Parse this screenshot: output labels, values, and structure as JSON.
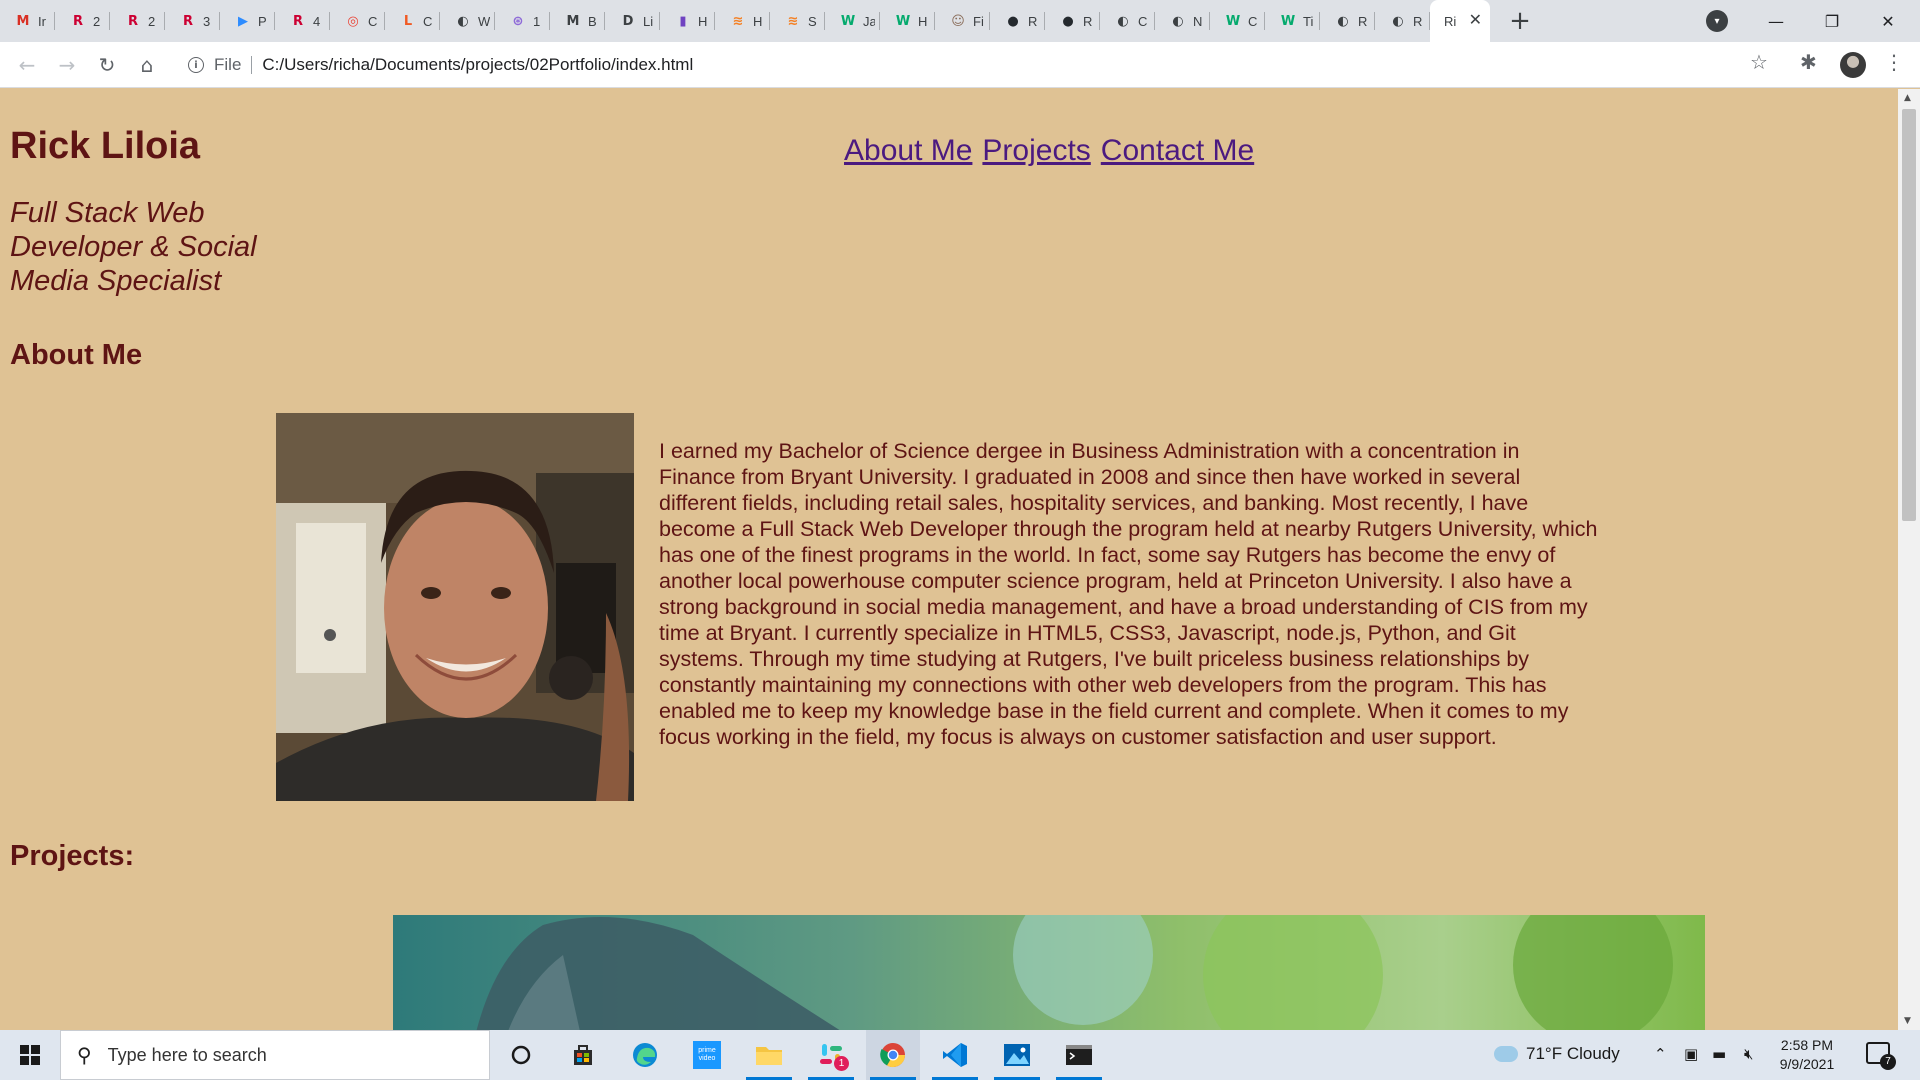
{
  "browser": {
    "tabs": [
      {
        "icon": "gmail-icon",
        "letter": "M",
        "color": "#d93025",
        "label": "Ir"
      },
      {
        "icon": "rutgers-icon",
        "letter": "R",
        "color": "#cc0033",
        "label": "2"
      },
      {
        "icon": "rutgers-icon",
        "letter": "R",
        "color": "#cc0033",
        "label": "2"
      },
      {
        "icon": "rutgers-icon",
        "letter": "R",
        "color": "#cc0033",
        "label": "3"
      },
      {
        "icon": "zoom-icon",
        "letter": "▶",
        "color": "#2d8cff",
        "label": "P"
      },
      {
        "icon": "rutgers-icon",
        "letter": "R",
        "color": "#cc0033",
        "label": "4"
      },
      {
        "icon": "chrome-icon",
        "letter": "◎",
        "color": "#ea4335",
        "label": "C"
      },
      {
        "icon": "codecademy-icon",
        "letter": "L",
        "color": "#f05a24",
        "label": "C"
      },
      {
        "icon": "globe-icon",
        "letter": "◐",
        "color": "#3c4043",
        "label": "W"
      },
      {
        "icon": "swirl-icon",
        "letter": "⊛",
        "color": "#8e6ad8",
        "label": "1"
      },
      {
        "icon": "md-icon",
        "letter": "M",
        "color": "#3c4043",
        "label": "B"
      },
      {
        "icon": "doc-icon",
        "letter": "D",
        "color": "#3c4043",
        "label": "Li"
      },
      {
        "icon": "purple-icon",
        "letter": "▮",
        "color": "#6f42c1",
        "label": "H"
      },
      {
        "icon": "stack-icon",
        "letter": "≋",
        "color": "#f48024",
        "label": "H"
      },
      {
        "icon": "stack-icon",
        "letter": "≋",
        "color": "#f48024",
        "label": "S"
      },
      {
        "icon": "w3schools-icon",
        "letter": "W",
        "color": "#04aa6d",
        "label": "Ja"
      },
      {
        "icon": "w3schools-icon",
        "letter": "W",
        "color": "#04aa6d",
        "label": "H"
      },
      {
        "icon": "avatar-icon",
        "letter": "☺",
        "color": "#8a6d5a",
        "label": "Fi"
      },
      {
        "icon": "github-icon",
        "letter": "●",
        "color": "#24292e",
        "label": "R"
      },
      {
        "icon": "github-icon",
        "letter": "●",
        "color": "#24292e",
        "label": "R"
      },
      {
        "icon": "globe-icon",
        "letter": "◐",
        "color": "#3c4043",
        "label": "C"
      },
      {
        "icon": "globe-icon",
        "letter": "◐",
        "color": "#3c4043",
        "label": "N"
      },
      {
        "icon": "w3schools-icon",
        "letter": "W",
        "color": "#04aa6d",
        "label": "C"
      },
      {
        "icon": "w3schools-icon",
        "letter": "W",
        "color": "#04aa6d",
        "label": "Ti"
      },
      {
        "icon": "globe-icon",
        "letter": "◐",
        "color": "#3c4043",
        "label": "R"
      },
      {
        "icon": "globe-icon",
        "letter": "◐",
        "color": "#3c4043",
        "label": "R"
      }
    ],
    "active_tab_label": "Ri",
    "new_tab_symbol": "+",
    "omnibox_scheme": "File",
    "omnibox_url": "C:/Users/richa/Documents/projects/02Portfolio/index.html"
  },
  "site": {
    "name": "Rick Liloia",
    "subtitle": "Full Stack Web Developer & Social Media Specialist",
    "nav": [
      "About Me",
      "Projects",
      "Contact Me"
    ],
    "about_heading": "About Me",
    "about_text": "I earned my Bachelor of Science dergee in Business Administration with a concentration in Finance from Bryant University. I graduated in 2008 and since then have worked in several different fields, including retail sales, hospitality services, and banking. Most recently, I have become a Full Stack Web Developer through the program held at nearby Rutgers University, which has one of the finest programs in the world. In fact, some say Rutgers has become the envy of another local powerhouse computer science program, held at Princeton University. I also have a strong background in social media management, and have a broad understanding of CIS from my time at Bryant. I currently specialize in HTML5, CSS3, Javascript, node.js, Python, and Git systems. Through my time studying at Rutgers, I've built priceless business relationships by constantly maintaining my connections with other web developers from the program. This has enabled me to keep my knowledge base in the field current and complete. When it comes to my focus working in the field, my focus is always on customer satisfaction and user support.",
    "projects_heading": "Projects:"
  },
  "taskbar": {
    "search_placeholder": "Type here to search",
    "weather": "71°F  Cloudy",
    "time": "2:58 PM",
    "date": "9/9/2021",
    "notification_count": "7",
    "slack_badge": "1",
    "prime_label": "prime video"
  },
  "colors": {
    "page_bg": "#dfc294",
    "heading": "#5e1414",
    "link": "#4b1a80"
  }
}
